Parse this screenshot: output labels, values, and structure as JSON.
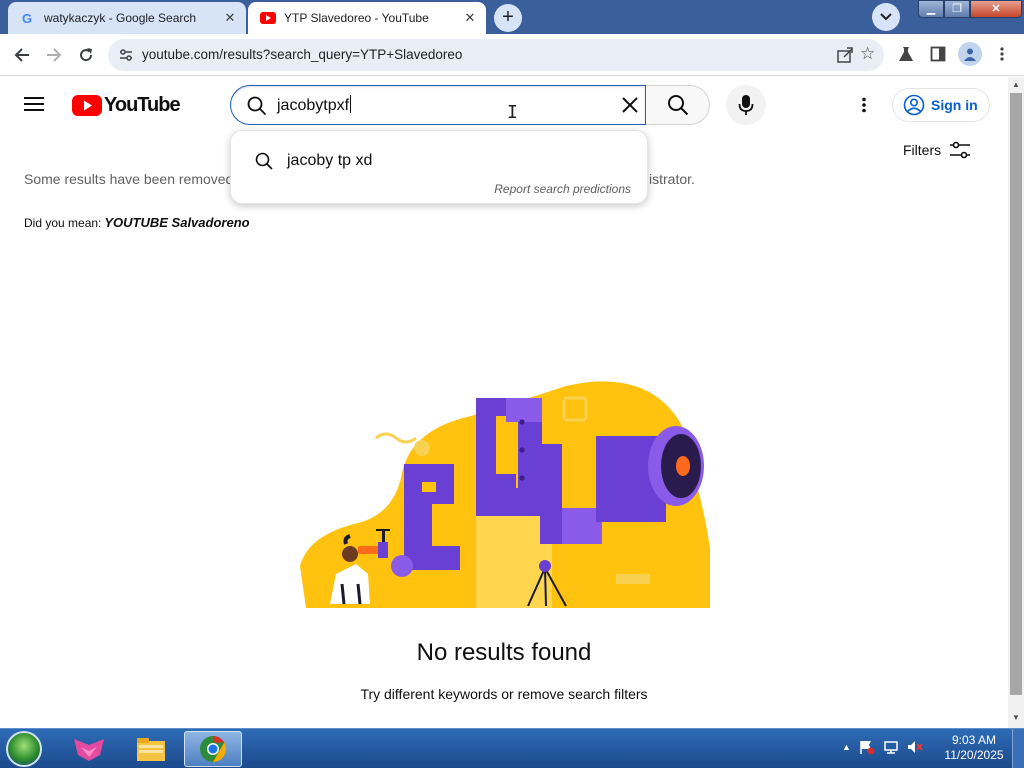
{
  "browser": {
    "tabs": [
      {
        "title": "watykaczyk - Google Search",
        "close": "✕",
        "active": false,
        "icon": "google-icon"
      },
      {
        "title": "YTP Slavedoreo - YouTube",
        "close": "✕",
        "active": true,
        "icon": "youtube-icon"
      }
    ],
    "new_tab": "+",
    "url": "youtube.com/results?search_query=YTP+Slavedoreo"
  },
  "youtube": {
    "logo_text": "YouTube",
    "search_query": "jacobytpxf",
    "sign_in": "Sign in",
    "filters": "Filters",
    "notice_start": "Some results have been removed",
    "notice_end": "istrator.",
    "did_you_mean_label": "Did you mean:",
    "did_you_mean_suggestion": "YOUTUBE Salvadoreno",
    "suggestions": [
      {
        "text": "jacoby tp xd"
      }
    ],
    "report_predictions": "Report search predictions",
    "no_results_title": "No results found",
    "no_results_sub": "Try different keywords or remove search filters",
    "brand_red": "#ff0000",
    "link_blue": "#065fd4"
  },
  "taskbar": {
    "apps": [
      "explorer-app",
      "file-manager-app",
      "chrome-app"
    ],
    "clock_time": "9:03 AM",
    "clock_date": "11/20/2025"
  }
}
